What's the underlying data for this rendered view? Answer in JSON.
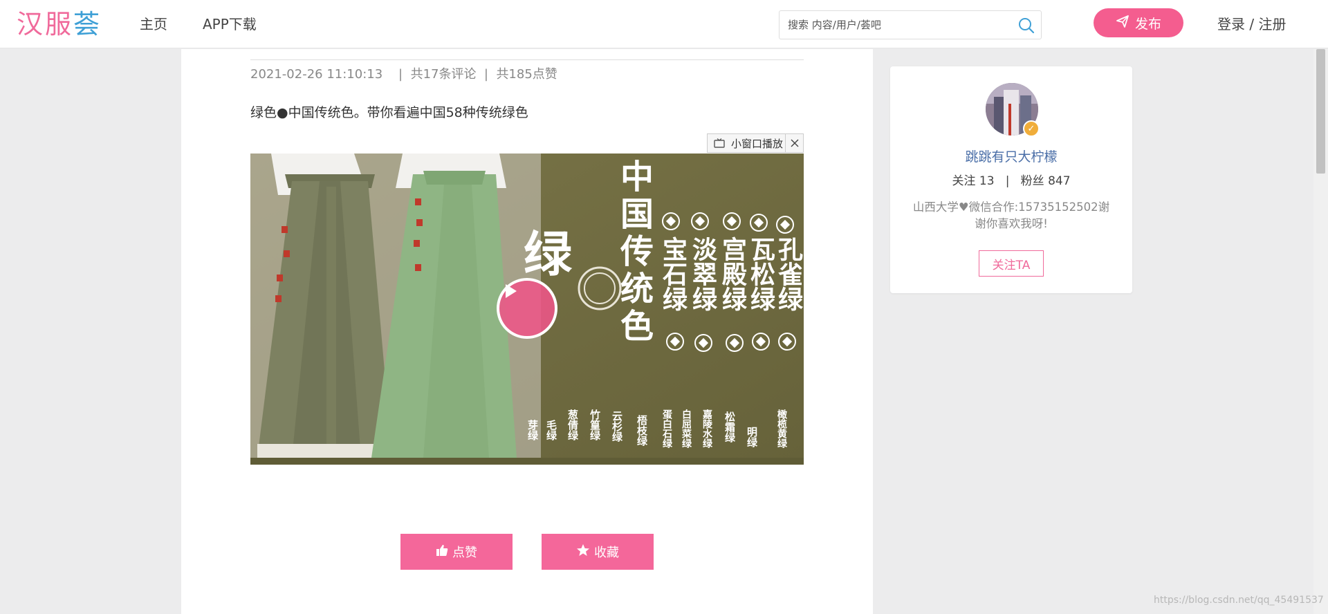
{
  "header": {
    "logo": {
      "part1": "汉服",
      "part2": "荟"
    },
    "nav": [
      {
        "label": "主页"
      },
      {
        "label": "APP下载"
      }
    ],
    "search": {
      "placeholder": "搜索 内容/用户/荟吧",
      "icon": "search-icon"
    },
    "publish": {
      "label": "发布",
      "icon": "paper-plane-icon"
    },
    "login_register": "登录 / 注册"
  },
  "post": {
    "datetime": "2021-02-26 11:10:13",
    "comments": "共17条评论",
    "likes": "共185点赞",
    "title": "绿色●中国传统色。带你看遍中国58种传统绿色",
    "mini_player": {
      "label": "小窗口播放",
      "icon": "tv-icon",
      "close_icon": "close-icon"
    },
    "video": {
      "play_icon": "play-icon",
      "overlay": {
        "big": "绿",
        "main_title": "中国传统色",
        "headline_columns": [
          "宝石绿",
          "淡翠绿",
          "宫殿绿",
          "瓦松绿",
          "孔雀绿"
        ],
        "bottom_columns": [
          "芽绿",
          "毛绿",
          "葱倩绿",
          "竹篁绿",
          "云杉绿",
          "梧枝绿",
          "蛋白石绿",
          "白屈菜绿",
          "嘉陵水绿",
          "松霜绿",
          "明绿",
          "橄榄黄绿"
        ]
      }
    },
    "actions": [
      {
        "label": "点赞",
        "icon": "thumbs-up-icon"
      },
      {
        "label": "收藏",
        "icon": "star-icon"
      }
    ]
  },
  "author": {
    "name": "跳跳有只大柠檬",
    "following": "关注 13",
    "followers": "粉丝 847",
    "bio": "山西大学♥微信合作:15735152502谢谢你喜欢我呀!",
    "follow_label": "关注TA",
    "avatar_icon": "avatar",
    "badge_icon": "verified-badge-icon"
  },
  "watermark": "https://blog.csdn.net/qq_45491537",
  "colors": {
    "accent": "#f4679a",
    "link": "#4a6ea7",
    "logo_blue": "#3fa0d6"
  }
}
